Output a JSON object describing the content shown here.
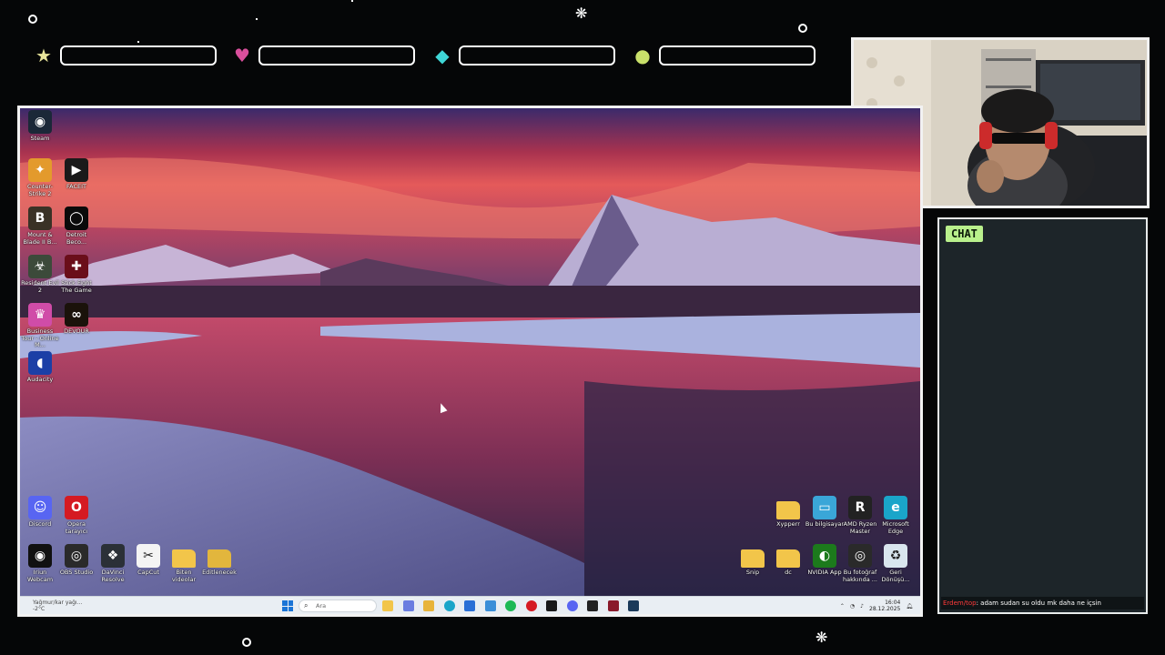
{
  "overlay": {
    "stat_bars": [
      {
        "icon": "star-icon",
        "glyph": "★",
        "color": "#e8e49a"
      },
      {
        "icon": "heart-icon",
        "glyph": "♥",
        "color": "#d94f9c"
      },
      {
        "icon": "diamond-icon",
        "glyph": "◆",
        "color": "#3fd6d6"
      },
      {
        "icon": "coin-icon",
        "glyph": "●",
        "color": "#c9e06a"
      }
    ]
  },
  "chat": {
    "title": "CHAT",
    "message": {
      "user": "Erdem/top",
      "text": ": adam sudan su oldu mk daha ne içsin"
    }
  },
  "desktop": {
    "left_icons": [
      {
        "label": "Steam",
        "icon": "steam-icon",
        "color": "#1b2838",
        "glyph": "◉"
      },
      {
        "label": "Counter-Strike 2",
        "icon": "counter-strike-icon",
        "color": "#e39a2c",
        "glyph": "✦"
      },
      {
        "label": "FACEIT",
        "icon": "faceit-icon",
        "color": "#1a1a1a",
        "glyph": "▶"
      },
      {
        "label": "Mount & Blade II B...",
        "icon": "bannerlord-icon",
        "color": "#3a3226",
        "glyph": "B"
      },
      {
        "label": "Detroit Beco...",
        "icon": "detroit-icon",
        "color": "#0a0a0a",
        "glyph": "◯"
      },
      {
        "label": "Resident Evil 2",
        "icon": "resident-evil-icon",
        "color": "#3c4a3a",
        "glyph": "☣"
      },
      {
        "label": "Stick Fight The Game",
        "icon": "stick-fight-icon",
        "color": "#6a0e1a",
        "glyph": "✚"
      },
      {
        "label": "Business Tour - Online M...",
        "icon": "business-tour-icon",
        "color": "#d04ca8",
        "glyph": "♛"
      },
      {
        "label": "DEVOUR",
        "icon": "devour-icon",
        "color": "#1a120a",
        "glyph": "∞"
      },
      {
        "label": "Audacity",
        "icon": "audacity-icon",
        "color": "#1c3fa6",
        "glyph": "◖"
      },
      {
        "label": "Discord",
        "icon": "discord-icon",
        "color": "#5865f2",
        "glyph": "☺"
      },
      {
        "label": "Opera tarayıcı",
        "icon": "opera-icon",
        "color": "#d51a22",
        "glyph": "O"
      },
      {
        "label": "Iriun Webcam",
        "icon": "iriun-webcam-icon",
        "color": "#111111",
        "glyph": "◉"
      },
      {
        "label": "OBS Studio",
        "icon": "obs-icon",
        "color": "#2a2a2a",
        "glyph": "◎"
      },
      {
        "label": "DaVinci Resolve",
        "icon": "davinci-icon",
        "color": "#2b3037",
        "glyph": "❖"
      },
      {
        "label": "CapCut",
        "icon": "capcut-icon",
        "color": "#f4f4f4",
        "glyph": "✂"
      },
      {
        "label": "Biten videolar",
        "icon": "folder-icon",
        "color": "#f2c54a",
        "glyph": ""
      },
      {
        "label": "Editlenecek",
        "icon": "folder-images-icon",
        "color": "#e2b63d",
        "glyph": ""
      }
    ],
    "right_icons": [
      {
        "label": "Xypperr",
        "icon": "folder-icon",
        "color": "#f2c54a",
        "glyph": ""
      },
      {
        "label": "Bu bilgisayar",
        "icon": "computer-icon",
        "color": "#3aa6d8",
        "glyph": "▭"
      },
      {
        "label": "AMD Ryzen Master",
        "icon": "amd-ryzen-icon",
        "color": "#222222",
        "glyph": "R"
      },
      {
        "label": "Microsoft Edge",
        "icon": "edge-icon",
        "color": "#1aa5c9",
        "glyph": "e"
      },
      {
        "label": "Snip",
        "icon": "folder-icon",
        "color": "#f2c54a",
        "glyph": ""
      },
      {
        "label": "dc",
        "icon": "folder-icon",
        "color": "#f2c54a",
        "glyph": ""
      },
      {
        "label": "NVIDIA App",
        "icon": "nvidia-icon",
        "color": "#1c7a1c",
        "glyph": "◐"
      },
      {
        "label": "Bu fotoğraf hakkında ...",
        "icon": "camera-icon",
        "color": "#2a2a2a",
        "glyph": "◎"
      },
      {
        "label": "Geri Dönüşü...",
        "icon": "recycle-bin-icon",
        "color": "#d9e6ee",
        "glyph": "♻"
      }
    ]
  },
  "taskbar": {
    "weather_text": "Yağmur/kar yağı...",
    "weather_temp": "-2°C",
    "search_placeholder": "Ara",
    "apps": [
      {
        "icon": "file-explorer-icon",
        "color": "#f2c54a"
      },
      {
        "icon": "copilot-icon",
        "color": "#6a7de0"
      },
      {
        "icon": "folder-icon",
        "color": "#e8b43a"
      },
      {
        "icon": "edge-icon",
        "color": "#1aa5c9"
      },
      {
        "icon": "store-icon",
        "color": "#2a6fd6"
      },
      {
        "icon": "outlook-icon",
        "color": "#3a8ed8"
      },
      {
        "icon": "spotify-icon",
        "color": "#1db954"
      },
      {
        "icon": "opera-icon",
        "color": "#d51a22"
      },
      {
        "icon": "faceit-icon",
        "color": "#1a1a1a"
      },
      {
        "icon": "discord-icon",
        "color": "#5865f2"
      },
      {
        "icon": "capcut-icon",
        "color": "#222222"
      },
      {
        "icon": "stick-fight-icon",
        "color": "#8a1a2a"
      },
      {
        "icon": "steam-icon",
        "color": "#1b3a5a"
      }
    ],
    "time": "16:04",
    "date": "28.12.2025"
  }
}
